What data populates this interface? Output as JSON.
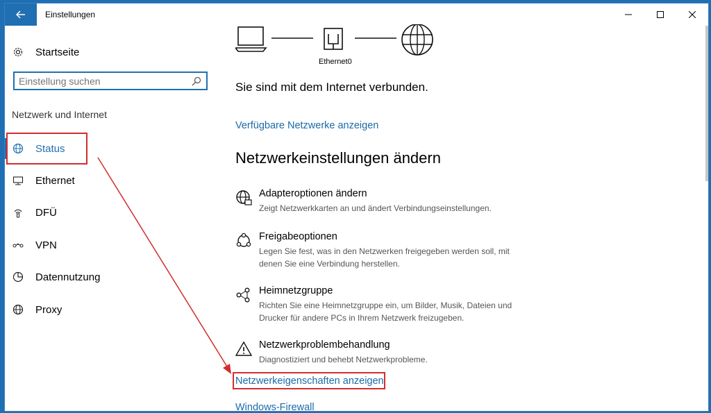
{
  "window": {
    "title": "Einstellungen"
  },
  "sidebar": {
    "home_label": "Startseite",
    "search_placeholder": "Einstellung suchen",
    "section_label": "Netzwerk und Internet",
    "items": [
      {
        "label": "Status",
        "icon": "globe-icon"
      },
      {
        "label": "Ethernet",
        "icon": "ethernet-icon"
      },
      {
        "label": "DFÜ",
        "icon": "dialup-icon"
      },
      {
        "label": "VPN",
        "icon": "vpn-icon"
      },
      {
        "label": "Datennutzung",
        "icon": "pie-chart-icon"
      },
      {
        "label": "Proxy",
        "icon": "globe-icon"
      }
    ]
  },
  "main": {
    "diagram": {
      "adapter_label": "Ethernet0"
    },
    "status_text": "Sie sind mit dem Internet verbunden.",
    "available_networks_link": "Verfügbare Netzwerke anzeigen",
    "heading": "Netzwerkeinstellungen ändern",
    "options": [
      {
        "title": "Adapteroptionen ändern",
        "desc": "Zeigt Netzwerkkarten an und ändert Verbindungseinstellungen.",
        "icon": "adapter-icon"
      },
      {
        "title": "Freigabeoptionen",
        "desc": "Legen Sie fest, was in den Netzwerken freigegeben werden soll, mit denen Sie eine Verbindung herstellen.",
        "icon": "sharing-icon"
      },
      {
        "title": "Heimnetzgruppe",
        "desc": "Richten Sie eine Heimnetzgruppe ein, um Bilder, Musik, Dateien und Drucker für andere PCs in Ihrem Netzwerk freizugeben.",
        "icon": "homegroup-icon"
      },
      {
        "title": "Netzwerkproblembehandlung",
        "desc": "Diagnostiziert und behebt Netzwerkprobleme.",
        "icon": "warning-icon"
      }
    ],
    "properties_link": "Netzwerkeigenschaften anzeigen",
    "firewall_link": "Windows-Firewall"
  },
  "colors": {
    "accent": "#1f6fb2",
    "link": "#1b6aa8",
    "highlight": "#d12d2d"
  }
}
